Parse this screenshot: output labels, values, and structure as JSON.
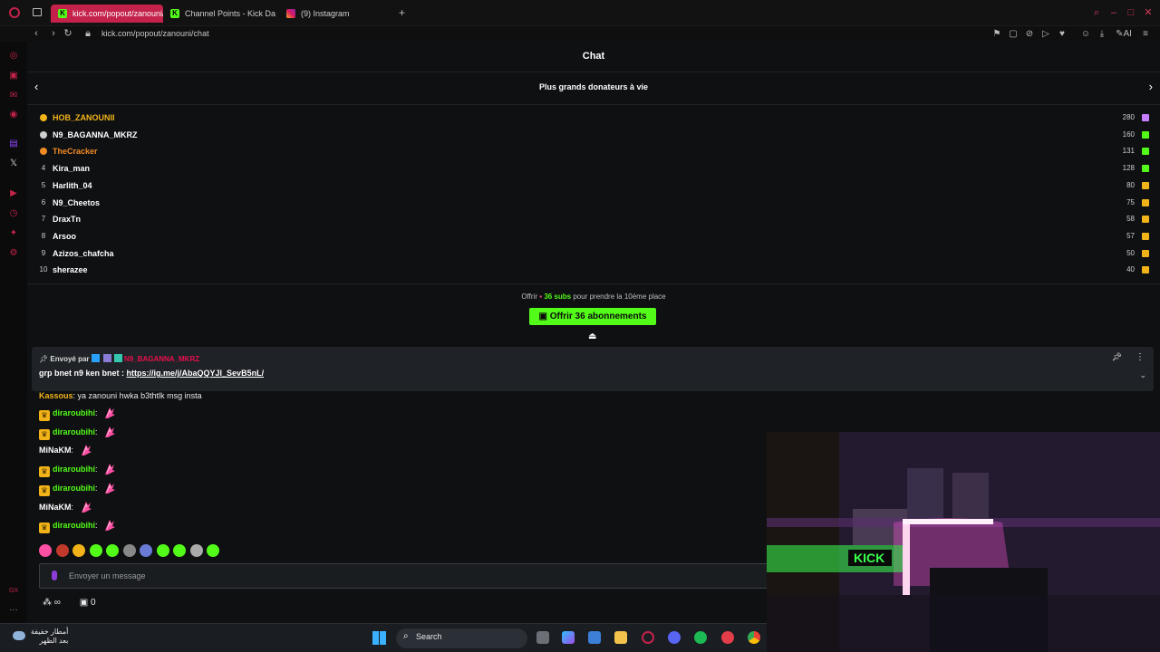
{
  "browser": {
    "tabs": [
      {
        "label": "kick.com/popout/zanouni/",
        "active": true
      },
      {
        "label": "Channel Points - Kick Das",
        "active": false
      },
      {
        "label": "(9) Instagram",
        "active": false
      }
    ],
    "url": "kick.com/popout/zanouni/chat",
    "ai_label": "AI"
  },
  "chat": {
    "title": "Chat",
    "leaderboard": {
      "title": "Plus grands donateurs à vie",
      "rows": [
        {
          "rank": "1",
          "name": "HOB_ZANOUNII",
          "count": "280",
          "highlight": "gold"
        },
        {
          "rank": "2",
          "name": "N9_BAGANNA_MKRZ",
          "count": "160",
          "highlight": "silver"
        },
        {
          "rank": "3",
          "name": "TheCracker",
          "count": "131",
          "highlight": "bronze"
        },
        {
          "rank": "4",
          "name": "Kira_man",
          "count": "128",
          "highlight": ""
        },
        {
          "rank": "5",
          "name": "Harlith_04",
          "count": "80",
          "highlight": ""
        },
        {
          "rank": "6",
          "name": "N9_Cheetos",
          "count": "75",
          "highlight": ""
        },
        {
          "rank": "7",
          "name": "DraxTn",
          "count": "58",
          "highlight": ""
        },
        {
          "rank": "8",
          "name": "Arsoo",
          "count": "57",
          "highlight": ""
        },
        {
          "rank": "9",
          "name": "Azizos_chafcha",
          "count": "50",
          "highlight": ""
        },
        {
          "rank": "10",
          "name": "sherazee",
          "count": "40",
          "highlight": ""
        }
      ],
      "offer_prefix": "Offrir",
      "offer_subs": "36 subs",
      "offer_suffix": "pour prendre la 10ème place",
      "offer_button": "Offrir 36 abonnements"
    },
    "pinned": {
      "sent_by_label": "Envoyé par",
      "sender": "N9_BAGANNA_MKRZ",
      "message_prefix": "grp bnet n9 ken bnet :",
      "link": "https://ig.me/j/AbaQQYJl_SevB5nL/"
    },
    "messages": [
      {
        "user": "Kassous",
        "text": "ya zanouni hwka b3thtlk msg insta",
        "color": "#f2b319",
        "badge": false,
        "emote": false
      },
      {
        "user": "diraroubihi",
        "text": "",
        "color": "#53fc18",
        "badge": true,
        "emote": true
      },
      {
        "user": "diraroubihi",
        "text": "",
        "color": "#53fc18",
        "badge": true,
        "emote": true
      },
      {
        "user": "MiNaKM",
        "text": "",
        "color": "#ffffff",
        "badge": false,
        "emote": true
      },
      {
        "user": "diraroubihi",
        "text": "",
        "color": "#53fc18",
        "badge": true,
        "emote": true
      },
      {
        "user": "diraroubihi",
        "text": "",
        "color": "#53fc18",
        "badge": true,
        "emote": true
      },
      {
        "user": "MiNaKM",
        "text": "",
        "color": "#ffffff",
        "badge": false,
        "emote": true
      },
      {
        "user": "diraroubihi",
        "text": "",
        "color": "#53fc18",
        "badge": true,
        "emote": true
      }
    ],
    "input_placeholder": "Envoyer un message",
    "bottom_count": "0"
  },
  "taskbar": {
    "weather_line1": "أمطار خفيفة",
    "weather_line2": "بعد الظهر",
    "search_label": "Search"
  },
  "colors": {
    "kick_green": "#53fc18",
    "opera_red": "#c4224a",
    "gold": "#f2b319"
  }
}
